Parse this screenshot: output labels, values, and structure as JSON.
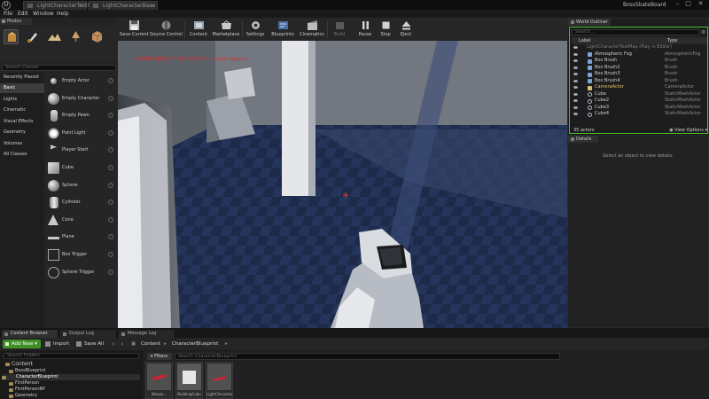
{
  "window": {
    "tabs": [
      {
        "label": "LightCharacterTestMap"
      },
      {
        "label": "LightCharacterBase"
      }
    ],
    "project_name": "BossSkateBoard",
    "controls": {
      "minimize": "–",
      "maximize": "□",
      "close": "✕"
    }
  },
  "menu": [
    "File",
    "Edit",
    "Window",
    "Help"
  ],
  "modes": {
    "tab_label": "Modes",
    "search_placeholder": "Search Classes",
    "categories": [
      "Recently Placed",
      "Basic",
      "Lights",
      "Cinematic",
      "Visual Effects",
      "Geometry",
      "Volumes",
      "All Classes"
    ],
    "active_category": "Basic",
    "items": [
      {
        "label": "Empty Actor",
        "icon": "sphere-icon"
      },
      {
        "label": "Empty Character",
        "icon": "character-icon"
      },
      {
        "label": "Empty Pawn",
        "icon": "pawn-icon"
      },
      {
        "label": "Point Light",
        "icon": "point-light-icon"
      },
      {
        "label": "Player Start",
        "icon": "player-start-icon"
      },
      {
        "label": "Cube",
        "icon": "cube-icon"
      },
      {
        "label": "Sphere",
        "icon": "sphere-icon"
      },
      {
        "label": "Cylinder",
        "icon": "cylinder-icon"
      },
      {
        "label": "Cone",
        "icon": "cone-icon"
      },
      {
        "label": "Plane",
        "icon": "plane-icon"
      },
      {
        "label": "Box Trigger",
        "icon": "box-trigger-icon"
      },
      {
        "label": "Sphere Trigger",
        "icon": "sphere-trigger-icon"
      }
    ],
    "help_glyph": "?"
  },
  "toolbar": [
    {
      "label": "Save Current",
      "icon": "save-icon"
    },
    {
      "label": "Source Control",
      "icon": "source-control-icon"
    },
    {
      "label": "Content",
      "icon": "content-icon"
    },
    {
      "label": "Marketplace",
      "icon": "marketplace-icon"
    },
    {
      "label": "Settings",
      "icon": "settings-icon"
    },
    {
      "label": "Blueprints",
      "icon": "blueprints-icon"
    },
    {
      "label": "Cinematics",
      "icon": "cinematics-icon"
    },
    {
      "label": "Build",
      "icon": "build-icon",
      "disabled": true
    },
    {
      "label": "Pause",
      "icon": "pause-icon"
    },
    {
      "label": "Stop",
      "icon": "stop-icon"
    },
    {
      "label": "Eject",
      "icon": "eject-icon"
    }
  ],
  "viewport": {
    "warning": "LIGHTING NEEDS TO BE REBUILT (1 unbuilt objects)"
  },
  "outliner": {
    "tab_label": "World Outliner",
    "search_placeholder": "Search...",
    "columns": {
      "label": "Label",
      "type": "Type"
    },
    "rows": [
      {
        "label": "LightCharacterTestMap (Play in Editor)",
        "type": "",
        "level": true
      },
      {
        "label": "Atmospheric Fog",
        "type": "AtmosphericFog",
        "icon": "fog"
      },
      {
        "label": "Box Brush",
        "type": "Brush",
        "icon": "brush"
      },
      {
        "label": "Box Brush2",
        "type": "Brush",
        "icon": "brush"
      },
      {
        "label": "Box Brush3",
        "type": "Brush",
        "icon": "brush"
      },
      {
        "label": "Box Brush4",
        "type": "Brush",
        "icon": "brush"
      },
      {
        "label": "CameraActor",
        "type": "CameraActor",
        "icon": "camera"
      },
      {
        "label": "Cube",
        "type": "StaticMeshActor",
        "icon": "mesh"
      },
      {
        "label": "Cube2",
        "type": "StaticMeshActor",
        "icon": "mesh"
      },
      {
        "label": "Cube3",
        "type": "StaticMeshActor",
        "icon": "mesh"
      },
      {
        "label": "Cube4",
        "type": "StaticMeshActor",
        "icon": "mesh"
      }
    ],
    "actor_count": "35 actors",
    "view_options": "View Options"
  },
  "details": {
    "tab_label": "Details",
    "empty_message": "Select an object to view details."
  },
  "bottom_tabs": [
    {
      "label": "Content Browser",
      "active": true
    },
    {
      "label": "Output Log",
      "active": false
    },
    {
      "label": "Message Log",
      "active": false
    }
  ],
  "content_browser": {
    "add_new": "Add New",
    "import": "Import",
    "save_all": "Save All",
    "breadcrumb": [
      "Content",
      "CharacterBlueprint"
    ],
    "search_folders_placeholder": "Search Folders",
    "folders": [
      {
        "label": "Content",
        "depth": 0
      },
      {
        "label": "BossBlueprint",
        "depth": 1
      },
      {
        "label": "CharacterBlueprint",
        "depth": 1,
        "selected": true
      },
      {
        "label": "FirstPerson",
        "depth": 1
      },
      {
        "label": "FirstPersonBP",
        "depth": 1
      },
      {
        "label": "Geometry",
        "depth": 1
      }
    ],
    "filters_label": "Filters",
    "search_assets_placeholder": "Search CharacterBlueprint",
    "assets": [
      {
        "label": "Weapo..."
      },
      {
        "label": "BuildingCube"
      },
      {
        "label": "LightCharacter"
      }
    ]
  },
  "colors": {
    "accent_green": "#4bbf2c",
    "add_new_green": "#3f8f26",
    "warning_red": "#e12a2a",
    "selection_blue": "#24488a",
    "viewport_floor": "#1a2540"
  }
}
